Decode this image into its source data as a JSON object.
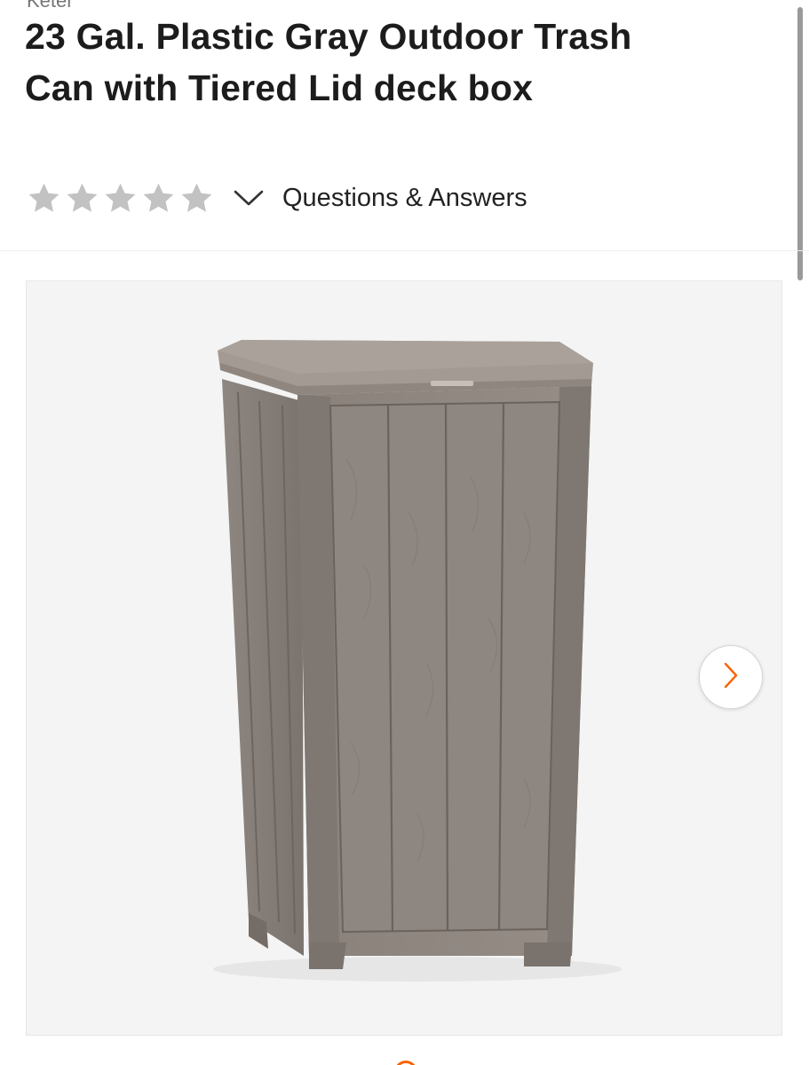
{
  "product": {
    "brand_partial": "Keter",
    "title": "23 Gal. Plastic Gray Outdoor Trash Can with Tiered Lid deck box"
  },
  "rating": {
    "stars_filled": 0,
    "stars_total": 5,
    "star_color": "#c2c2c2",
    "questions_label": "Questions & Answers"
  },
  "gallery": {
    "image": "gray-outdoor-trash-can",
    "next_icon": "chevron-right-icon",
    "current_index": 1
  },
  "colors": {
    "accent": "#f96302",
    "text": "#1c1c1c",
    "image_bg": "#f4f4f4"
  }
}
